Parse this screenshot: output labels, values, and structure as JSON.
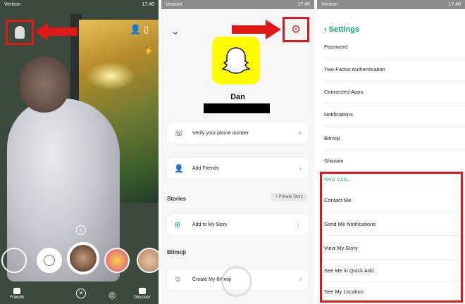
{
  "panel_left": {
    "status_left": "Verizon",
    "status_right": "17:40",
    "bottom_bar": {
      "left_label": "Friends",
      "right_label": "Discover"
    }
  },
  "panel_middle": {
    "status_left": "Verizon",
    "status_right": "17:40",
    "user_name": "Dan",
    "cards": [
      {
        "label": "Verify your phone number",
        "icon": "phone-check-icon",
        "end": "×"
      },
      {
        "label": "Add Friends",
        "icon": "add-friend-icon",
        "end": "›"
      }
    ],
    "stories_header": "Stories",
    "stories_pill": "+ Private Story",
    "story_card": {
      "label": "Add to My Story",
      "icon": "camera-plus-icon",
      "end": "⋮"
    },
    "bitmoji_header": "Bitmoji",
    "bitmoji_card": {
      "label": "Create My Bitmoji",
      "icon": "bitmoji-face-icon",
      "end": "›"
    }
  },
  "panel_right": {
    "status_left": "Verizon",
    "status_right": "17:40",
    "title": "Settings",
    "rows": [
      "Password",
      "Two-Factor Authentication",
      "Connected Apps",
      "Notifications",
      "Bitmoji",
      "Shazam"
    ],
    "section_header": "WHO CAN...",
    "who_can_rows": [
      "Contact Me",
      "Send Me Notifications",
      "View My Story",
      "See Me in Quick Add",
      "See My Location"
    ]
  },
  "colors": {
    "highlight_red": "#e01818",
    "snap_yellow": "#fffc00",
    "settings_green": "#0ca678"
  }
}
